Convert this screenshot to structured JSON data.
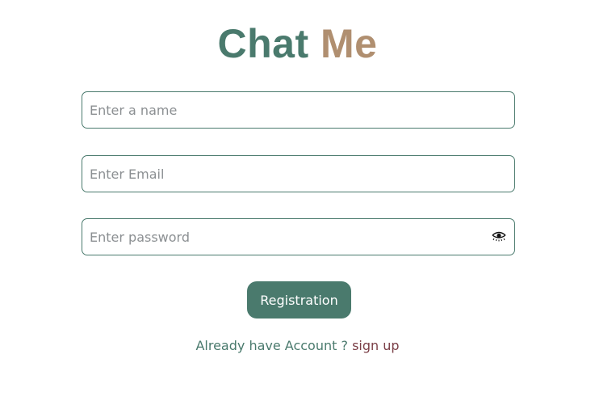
{
  "app": {
    "title_part1": "Chat",
    "title_part2": "Me"
  },
  "form": {
    "name_placeholder": "Enter a name",
    "email_placeholder": "Enter Email",
    "password_placeholder": "Enter password",
    "password_toggle_icon": "eye-icon",
    "submit_label": "Registration"
  },
  "footer": {
    "question": "Already have Account ?",
    "link_label": "sign up"
  },
  "colors": {
    "primary": "#4a7a6d",
    "accent": "#b08f70",
    "link": "#7a3e46"
  }
}
